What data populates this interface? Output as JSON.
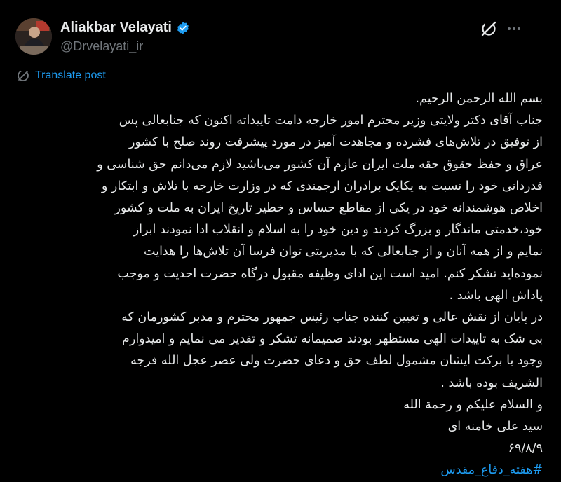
{
  "author": {
    "display_name": "Aliakbar Velayati",
    "handle": "@Drvelayati_ir"
  },
  "translate_label": "Translate post",
  "post_lines": [
    "بسم الله الرحمن الرحیم.",
    "جناب آقای دکتر ولایتی وزیر محترم امور خارجه دامت تاییداته اکنون که جنابعالی پس",
    "از توفیق در تلاش‌های فشرده و مجاهدت آمیز در مورد پیشرفت روند صلح با کشور",
    "عراق و حفظ حقوق حقه ملت ایران عازم آن کشور می‌باشید لازم می‌دانم حق شناسی و",
    "قدردانی خود را نسبت به یکایک برادران ارجمندی که در وزارت خارجه با تلاش و ابتکار و",
    "اخلاص هوشمندانه خود در یکی از مقاطع حساس و خطیر تاریخ ایران به ملت و کشور",
    "خود،خدمتی ماندگار و بزرگ کردند و دین خود را به اسلام و انقلاب ادا نمودند ابراز",
    "نمایم و از همه آنان و از جنابعالی که با مدیریتی توان فرسا آن تلاش‌ها را هدایت",
    "نموده‌اید تشکر کنم. امید است این ادای وظیفه مقبول درگاه حضرت احدیت و موجب",
    "پاداش الهی باشد .",
    "در پایان از نقش عالی و تعیین کننده جناب رئیس جمهور محترم و مدبر کشورمان که",
    "بی شک به تاییدات الهی مستظهر بودند صمیمانه تشکر و تقدیر می نمایم و امیدوارم",
    "وجود با برکت ایشان مشمول لطف حق و دعای حضرت ولی عصر عجل الله فرجه",
    "الشریف بوده باشد .",
    "و السلام علیکم و رحمة الله",
    "سید علی خامنه ای",
    "۶۹/۸/۹"
  ],
  "hashtag": "#هفته_دفاع_مقدس",
  "colors": {
    "background": "#000000",
    "text": "#e7e9ea",
    "secondary": "#71767b",
    "accent": "#1d9bf0"
  },
  "icons": {
    "verified": "verified-badge-icon",
    "grok": "grok-icon",
    "more": "more-options-icon",
    "translate": "translate-icon"
  }
}
